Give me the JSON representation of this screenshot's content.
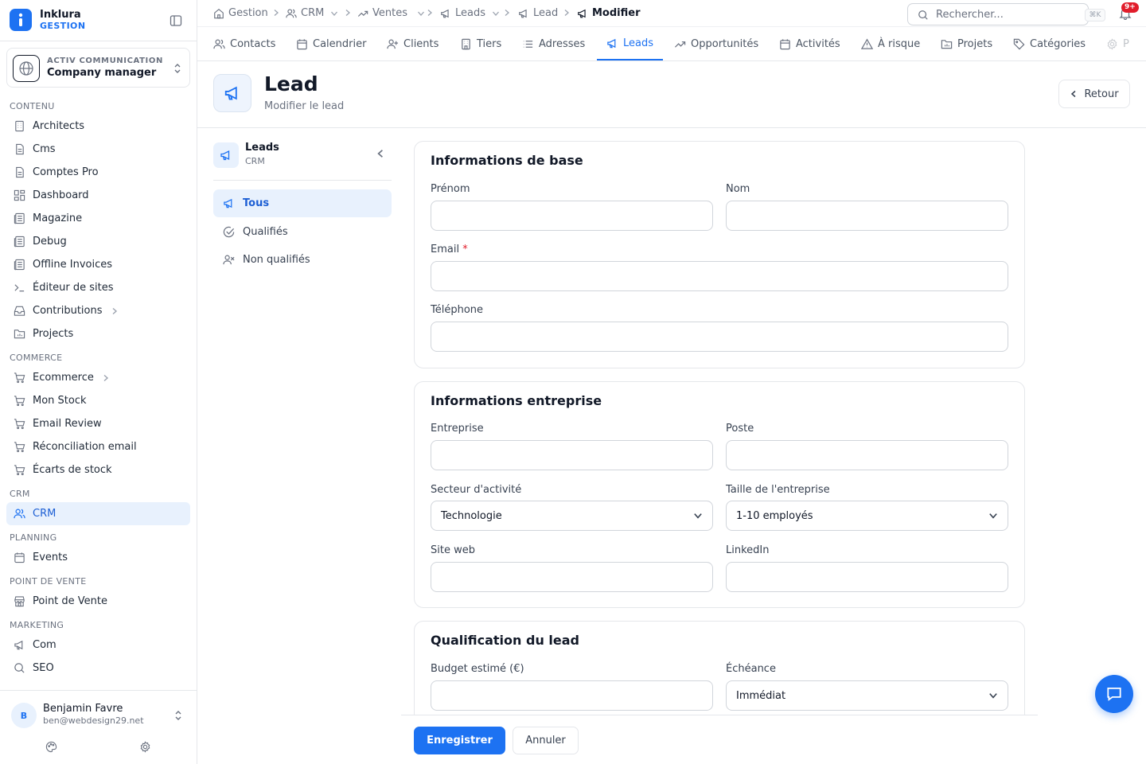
{
  "brand": {
    "name": "Inklura",
    "sub": "GESTION"
  },
  "org": {
    "company": "ACTIV COMMUNICATION",
    "role": "Company manager"
  },
  "sidebar": {
    "sections": {
      "contenu": "CONTENU",
      "commerce": "COMMERCE",
      "crm": "CRM",
      "planning": "PLANNING",
      "pdv": "POINT DE VENTE",
      "marketing": "MARKETING"
    },
    "items": {
      "architects": "Architects",
      "cms": "Cms",
      "comptes_pro": "Comptes Pro",
      "dashboard": "Dashboard",
      "magazine": "Magazine",
      "debug": "Debug",
      "offline_invoices": "Offline Invoices",
      "editeur": "Éditeur de sites",
      "contributions": "Contributions",
      "projects": "Projects",
      "ecommerce": "Ecommerce",
      "mon_stock": "Mon Stock",
      "email_review": "Email Review",
      "reconciliation": "Réconciliation email",
      "ecarts": "Écarts de stock",
      "crm": "CRM",
      "events": "Events",
      "pdv": "Point de Vente",
      "com": "Com",
      "seo": "SEO"
    }
  },
  "user": {
    "initial": "B",
    "name": "Benjamin Favre",
    "email": "ben@webdesign29.net"
  },
  "breadcrumb": {
    "gestion": "Gestion",
    "crm": "CRM",
    "ventes": "Ventes",
    "leads": "Leads",
    "lead": "Lead",
    "current": "Modifier"
  },
  "search": {
    "placeholder": "Rechercher...",
    "shortcut": "⌘K"
  },
  "notifications": {
    "count": "9+"
  },
  "tabs": {
    "contacts": "Contacts",
    "calendrier": "Calendrier",
    "clients": "Clients",
    "tiers": "Tiers",
    "adresses": "Adresses",
    "leads": "Leads",
    "opportunites": "Opportunités",
    "activites": "Activités",
    "a_risque": "À risque",
    "projets": "Projets",
    "categories": "Catégories",
    "overflow": "P"
  },
  "page": {
    "title": "Lead",
    "subtitle": "Modifier le lead",
    "back": "Retour"
  },
  "subnav": {
    "title": "Leads",
    "sub": "CRM",
    "items": {
      "tous": "Tous",
      "qualifies": "Qualifiés",
      "non_qualifies": "Non qualifiés"
    }
  },
  "form": {
    "base": {
      "title": "Informations de base",
      "prenom": "Prénom",
      "nom": "Nom",
      "email": "Email",
      "email_required": "*",
      "telephone": "Téléphone"
    },
    "entreprise": {
      "title": "Informations entreprise",
      "entreprise": "Entreprise",
      "poste": "Poste",
      "secteur_label": "Secteur d'activité",
      "secteur_value": "Technologie",
      "taille_label": "Taille de l'entreprise",
      "taille_value": "1-10 employés",
      "site_web": "Site web",
      "linkedin": "LinkedIn"
    },
    "qualification": {
      "title": "Qualification du lead",
      "budget": "Budget estimé (€)",
      "echeance_label": "Échéance",
      "echeance_value": "Immédiat"
    },
    "values": {
      "prenom": "",
      "nom": "",
      "email": "",
      "telephone": "",
      "entreprise": "",
      "poste": "",
      "site_web": "",
      "linkedin": "",
      "budget": ""
    }
  },
  "actions": {
    "save": "Enregistrer",
    "cancel": "Annuler"
  },
  "colors": {
    "accent": "#1d72f2",
    "badge": "#e11d2b",
    "active_bg": "#e8f1fd"
  }
}
